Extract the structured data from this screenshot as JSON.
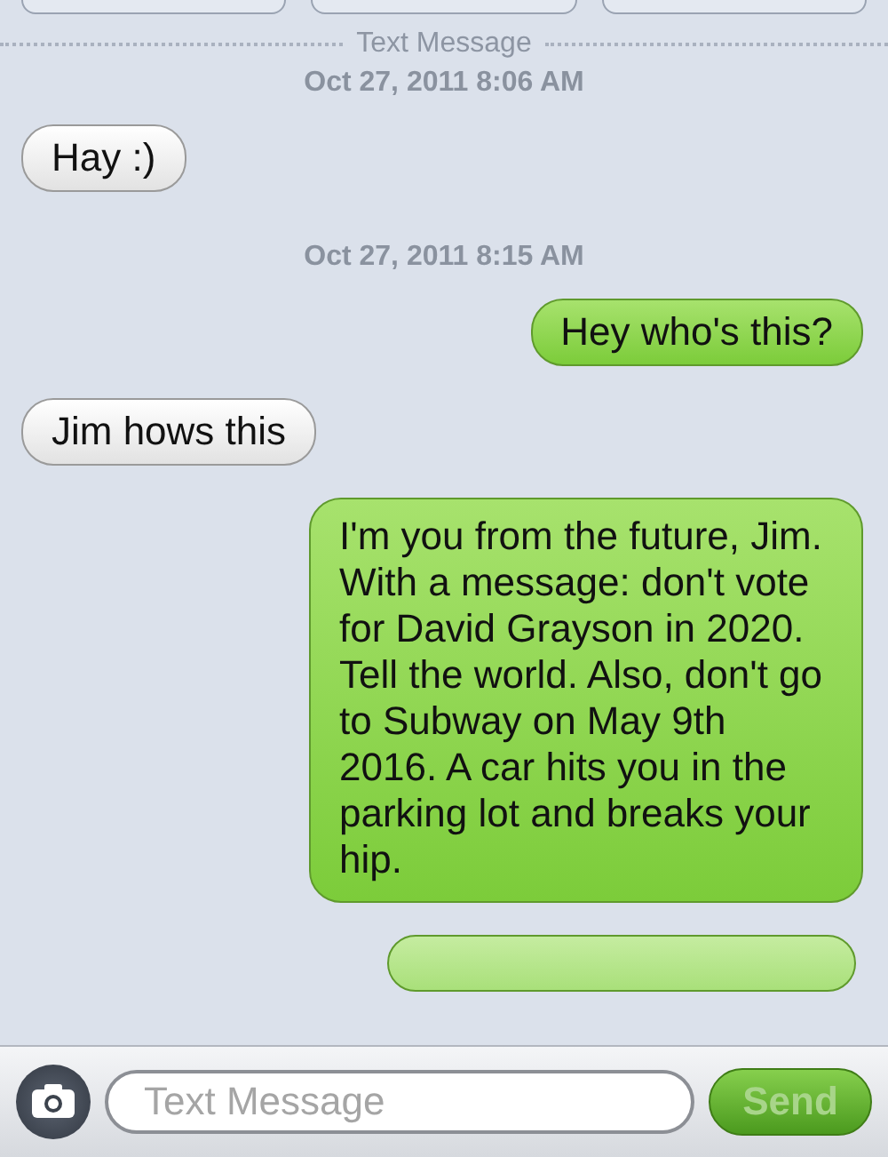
{
  "thread": {
    "label": "Text Message"
  },
  "items": [
    {
      "kind": "timestamp",
      "text": "Oct 27, 2011 8:06 AM"
    },
    {
      "kind": "received",
      "text": "Hay :)"
    },
    {
      "kind": "timestamp",
      "text": "Oct 27, 2011 8:15 AM"
    },
    {
      "kind": "sent",
      "text": "Hey who's this?"
    },
    {
      "kind": "received",
      "text": "Jim hows this"
    },
    {
      "kind": "sent",
      "text": "I'm you from the future, Jim. With a message: don't vote for David Grayson in 2020. Tell the world. Also, don't go to Subway on May 9th 2016. A car hits you in the parking lot and breaks your hip."
    },
    {
      "kind": "sent_cut"
    }
  ],
  "composer": {
    "placeholder": "Text Message",
    "send": {
      "label": "Send",
      "disabled": true
    }
  }
}
